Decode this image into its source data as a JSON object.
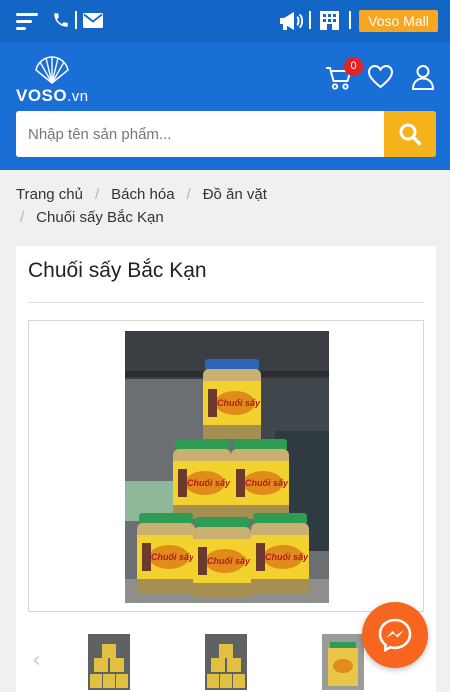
{
  "topbar": {
    "mall_label": "Voso Mall",
    "icons": [
      "menu-icon",
      "phone-icon",
      "mail-icon",
      "megaphone-icon",
      "store-icon"
    ]
  },
  "header": {
    "logo": {
      "brand": "VOSO",
      "suffix": ".vn"
    },
    "cart_count": "0",
    "icons": [
      "cart-icon",
      "heart-icon",
      "user-icon"
    ]
  },
  "search": {
    "placeholder": "Nhập tên sản phẩm...",
    "value": "",
    "icon": "search-icon"
  },
  "breadcrumb": {
    "items": [
      "Trang chủ",
      "Bách hóa",
      "Đồ ăn vặt",
      "Chuối sấy Bắc Kạn"
    ]
  },
  "product": {
    "title": "Chuối sấy Bắc Kạn",
    "jar_label": "Chuối sấy",
    "thumbnails_count": 3
  },
  "colors": {
    "topbar": "#1466c6",
    "header": "#1a6fd6",
    "accent_yellow": "#f6b21b",
    "mall_orange": "#f6a623",
    "badge_red": "#e52323",
    "messenger_orange": "#f6661f"
  },
  "floating": {
    "icon": "messenger-icon"
  }
}
